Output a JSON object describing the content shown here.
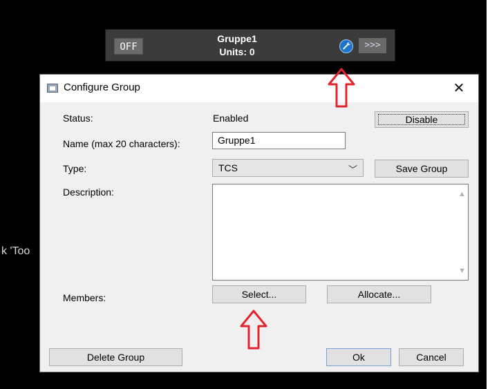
{
  "background_text": "k 'Too",
  "group_widget": {
    "off_label": "OFF",
    "title": "Gruppe1",
    "units": "Units: 0",
    "more_label": ">>>"
  },
  "dialog": {
    "title": "Configure Group",
    "status_label": "Status:",
    "status_value": "Enabled",
    "disable_label": "Disable",
    "name_label": "Name (max 20 characters):",
    "name_value": "Gruppe1",
    "type_label": "Type:",
    "type_value": "TCS",
    "save_group_label": "Save Group",
    "description_label": "Description:",
    "members_label": "Members:",
    "select_label": "Select...",
    "allocate_label": "Allocate...",
    "delete_group_label": "Delete Group",
    "ok_label": "Ok",
    "cancel_label": "Cancel"
  },
  "colors": {
    "annotation_arrow": "#e0242c",
    "wrench_accent": "#1e74c8"
  }
}
